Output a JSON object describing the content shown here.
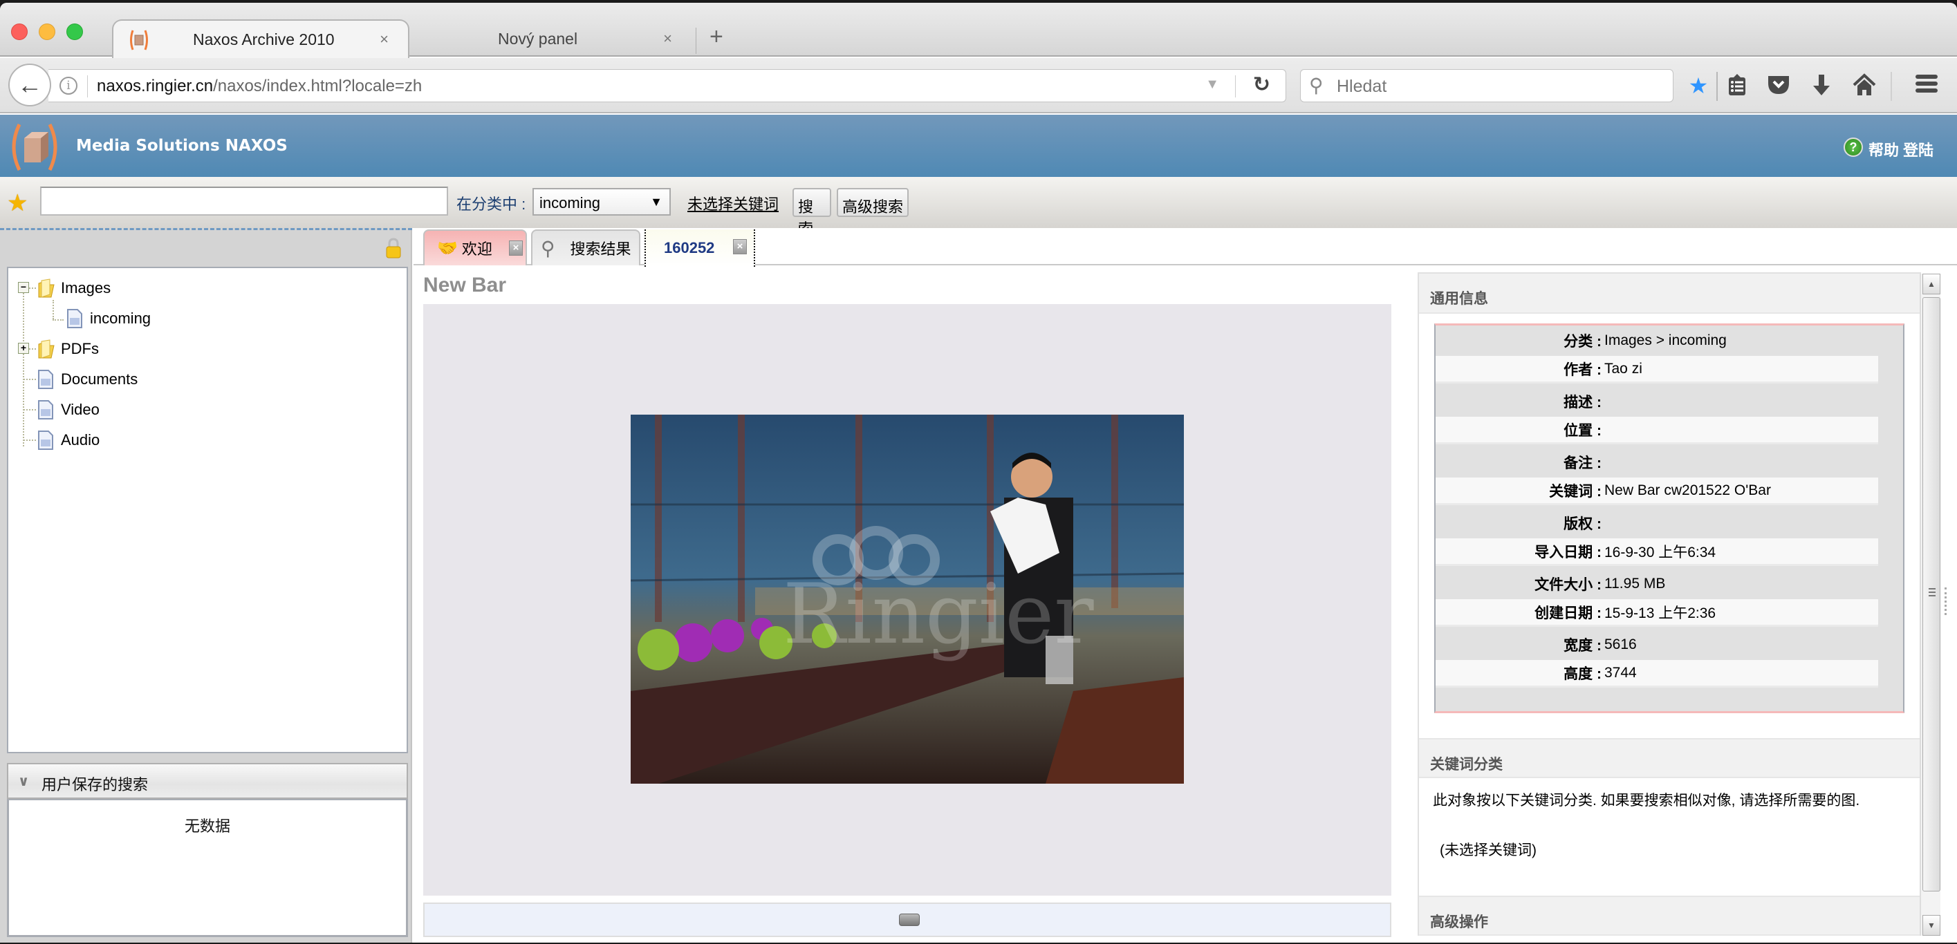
{
  "browser": {
    "tabs": [
      {
        "title": "Naxos Archive 2010",
        "active": true,
        "close_label": "×"
      },
      {
        "title": "Nový panel",
        "active": false,
        "close_label": "×"
      }
    ],
    "new_tab_label": "+",
    "url": {
      "host": "naxos.ringier.cn",
      "path": "/naxos/index.html?locale=zh"
    },
    "search_placeholder": "Hledat",
    "toolbar_icons": [
      "bookmark-star-icon",
      "reading-list-icon",
      "pocket-icon",
      "download-icon",
      "home-icon",
      "menu-icon"
    ],
    "accent_color": "#2f95ff"
  },
  "app": {
    "title": "Media Solutions NAXOS",
    "header_color": "#5a8db7",
    "help_label": "帮助",
    "login_label": "登陆"
  },
  "searchbar": {
    "keyword_value": "",
    "in_category_label": "在分类中 :",
    "category_selected": "incoming",
    "no_keyword_link": "未选择关键词",
    "search_button": "搜索",
    "advanced_search_button": "高级搜索"
  },
  "tree": {
    "items": [
      {
        "label": "Images",
        "type": "folder",
        "expanded": true,
        "toggle": "−"
      },
      {
        "label": "incoming",
        "type": "leaf",
        "depth": 1
      },
      {
        "label": "PDFs",
        "type": "folder",
        "expanded": false,
        "toggle": "+"
      },
      {
        "label": "Documents",
        "type": "leaf"
      },
      {
        "label": "Video",
        "type": "leaf"
      },
      {
        "label": "Audio",
        "type": "leaf"
      }
    ]
  },
  "saved_searches": {
    "title": "用户保存的搜索",
    "empty_text": "无数据"
  },
  "app_tabs": [
    {
      "label": "欢迎",
      "icon": "handshake-icon",
      "closable": true
    },
    {
      "label": "搜索结果",
      "icon": "search-icon",
      "closable": false
    },
    {
      "label": "160252",
      "active": true,
      "closable": true
    }
  ],
  "asset": {
    "title": "New Bar",
    "watermark": "Ringier"
  },
  "general_info": {
    "title": "通用信息",
    "rows": [
      {
        "key": "分类 :",
        "value": "Images > incoming"
      },
      {
        "key": "作者 :",
        "value": "Tao zi"
      },
      {
        "key": "描述 :",
        "value": ""
      },
      {
        "key": "位置 :",
        "value": ""
      },
      {
        "key": "备注 :",
        "value": ""
      },
      {
        "key": "关键词 :",
        "value": "New Bar cw201522 O'Bar"
      },
      {
        "key": "版权 :",
        "value": ""
      },
      {
        "key": "导入日期 :",
        "value": "16-9-30 上午6:34"
      },
      {
        "key": "文件大小 :",
        "value": "11.95 MB"
      },
      {
        "key": "创建日期 :",
        "value": "15-9-13 上午2:36"
      },
      {
        "key": "宽度 :",
        "value": "5616"
      },
      {
        "key": "高度 :",
        "value": "3744"
      }
    ]
  },
  "keyword_classification": {
    "title": "关键词分类",
    "description": "此对象按以下关键词分类. 如果要搜索相似对像, 请选择所需要的图.",
    "none_selected": "(未选择关键词)"
  },
  "advanced_ops": {
    "title": "高级操作"
  }
}
